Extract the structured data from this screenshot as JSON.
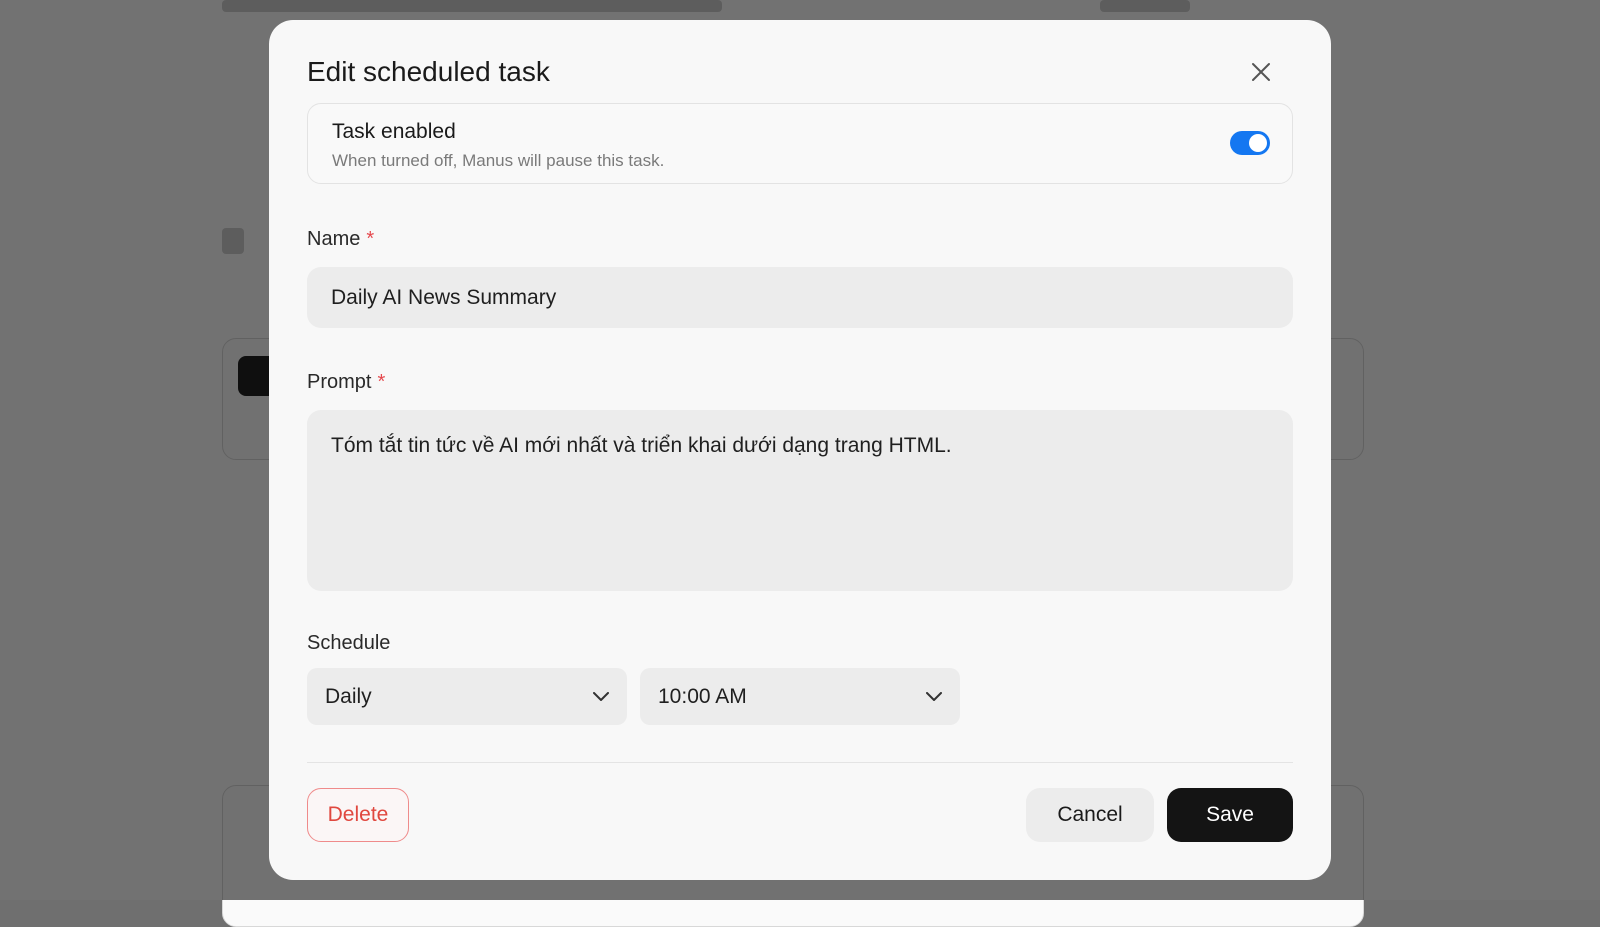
{
  "modal": {
    "title": "Edit scheduled task",
    "toggle": {
      "title": "Task enabled",
      "description": "When turned off, Manus will pause this task.",
      "enabled": true
    },
    "name_field": {
      "label": "Name",
      "required_mark": "*",
      "value": "Daily AI News Summary"
    },
    "prompt_field": {
      "label": "Prompt",
      "required_mark": "*",
      "value": "Tóm tắt tin tức về AI mới nhất và triển khai dưới dạng trang HTML."
    },
    "schedule": {
      "label": "Schedule",
      "frequency": "Daily",
      "time": "10:00 AM"
    },
    "buttons": {
      "delete": "Delete",
      "cancel": "Cancel",
      "save": "Save"
    }
  },
  "colors": {
    "accent": "#1477f1",
    "danger": "#e0483f",
    "primary_button": "#141414"
  },
  "icons": [
    "close-icon",
    "chevron-down-icon"
  ]
}
